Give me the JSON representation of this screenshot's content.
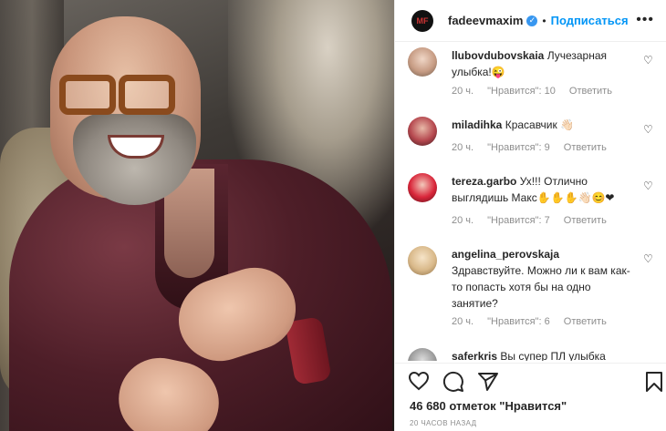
{
  "header": {
    "username": "fadeevmaxim",
    "avatar_text": "MF",
    "separator": "•",
    "follow_label": "Подписаться",
    "more_label": "•••"
  },
  "comments": [
    {
      "username": "llubovdubovskaia",
      "text": "Лучезарная улыбка!😜",
      "time": "20 ч.",
      "likes": "\"Нравится\": 10",
      "reply": "Ответить"
    },
    {
      "username": "miladihka",
      "text": "Красавчик 👋🏻",
      "time": "20 ч.",
      "likes": "\"Нравится\": 9",
      "reply": "Ответить"
    },
    {
      "username": "tereza.garbo",
      "text": "Ух!!! Отлично выглядишь Макс✋✋✋👋🏻😊❤",
      "time": "20 ч.",
      "likes": "\"Нравится\": 7",
      "reply": "Ответить"
    },
    {
      "username": "angelina_perovskaja",
      "text": "Здравствуйте. Можно ли к вам как-то попасть хотя бы на одно занятие?",
      "time": "20 ч.",
      "likes": "\"Нравится\": 6",
      "reply": "Ответить"
    },
    {
      "username": "saferkris",
      "text": "Вы супер ПЛ улыбка",
      "time": "",
      "likes": "",
      "reply": ""
    }
  ],
  "likes_text": "46 680 отметок \"Нравится\"",
  "timestamp": "20 ЧАСОВ НАЗАД",
  "colors": {
    "accent": "#0095f6",
    "verified": "#3897f0",
    "muted": "#8e8e8e"
  },
  "icons": {
    "like": "heart-icon",
    "comment": "comment-icon",
    "share": "share-icon",
    "save": "bookmark-icon"
  }
}
